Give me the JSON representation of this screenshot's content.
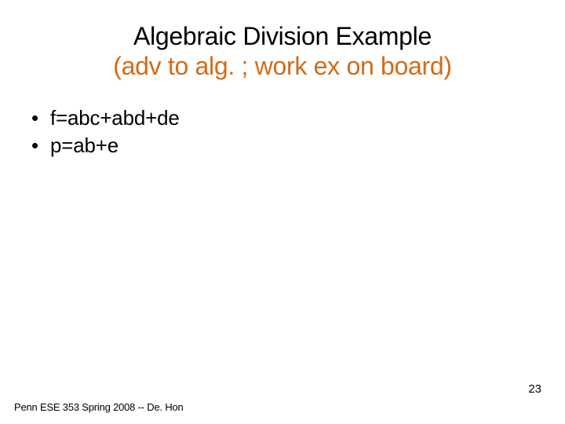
{
  "title": {
    "line1": "Algebraic Division Example",
    "line2": "(adv to alg. ; work ex on board)"
  },
  "bullets": [
    "f=abc+abd+de",
    "p=ab+e"
  ],
  "footer": "Penn ESE 353 Spring 2008 -- De. Hon",
  "page_number": "23",
  "colors": {
    "accent": "#d56a16"
  }
}
